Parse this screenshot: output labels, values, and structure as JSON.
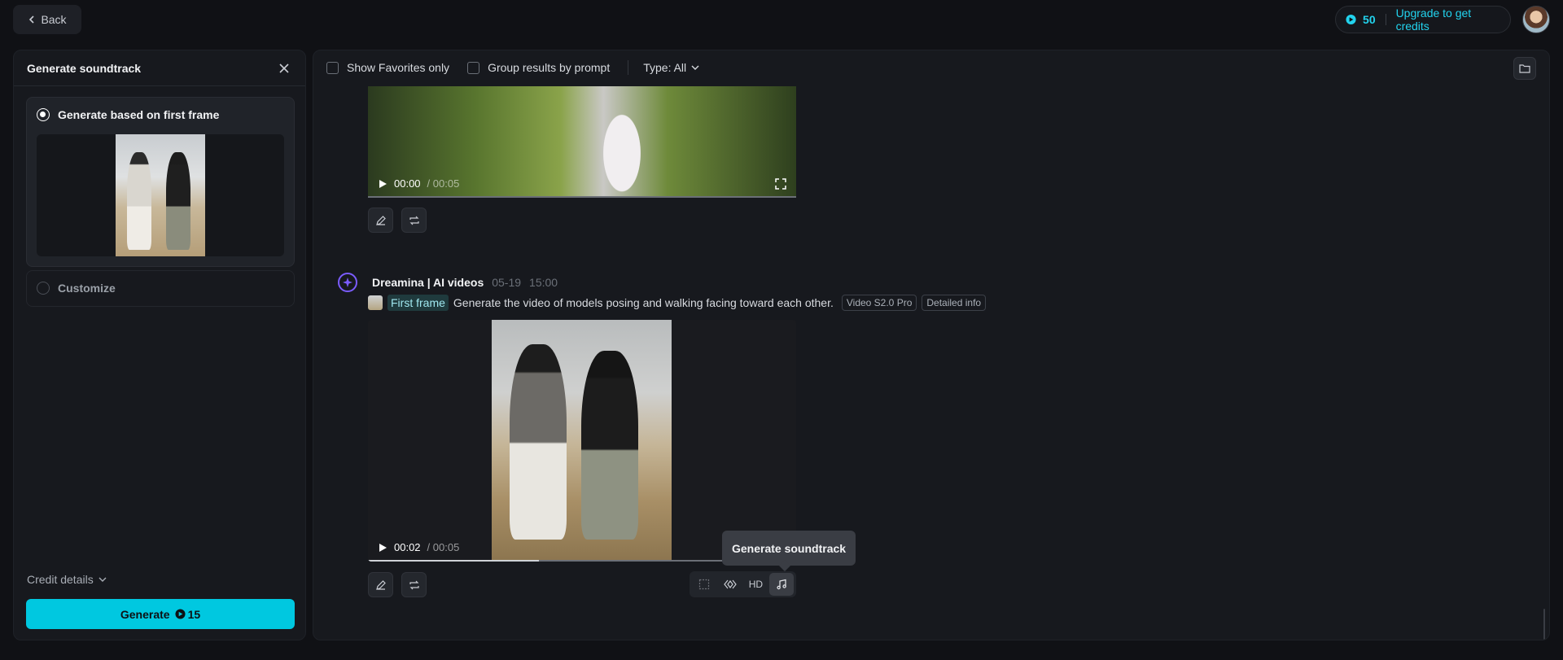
{
  "topbar": {
    "back_label": "Back",
    "credits_count": "50",
    "upgrade_label": "Upgrade to get credits"
  },
  "left_panel": {
    "title": "Generate soundtrack",
    "option_first_frame": "Generate based on first frame",
    "option_customize": "Customize",
    "credit_details_label": "Credit details",
    "generate_label": "Generate",
    "generate_cost": "15"
  },
  "toolbar": {
    "favorites_label": "Show Favorites only",
    "group_label": "Group results by prompt",
    "type_label": "Type: All"
  },
  "video1": {
    "current_time": "00:00",
    "duration": "/ 00:05",
    "progress_fraction": 0.0
  },
  "entry": {
    "author": "Dreamina | AI videos",
    "date": "05-19",
    "time": "15:00",
    "first_frame_chip": "First frame",
    "prompt": "Generate the video of models posing and walking facing toward each other.",
    "tag_model": "Video S2.0 Pro",
    "tag_info": "Detailed info"
  },
  "video2": {
    "current_time": "00:02",
    "duration": "/ 00:05",
    "progress_fraction": 0.4
  },
  "tools": {
    "hd_label": "HD",
    "tooltip": "Generate soundtrack"
  },
  "colors": {
    "accent": "#00c8e0",
    "background": "#101115",
    "panel": "#17191e"
  }
}
